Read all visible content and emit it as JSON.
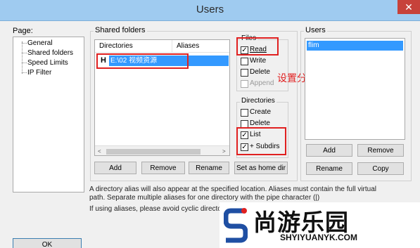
{
  "window": {
    "title": "Users",
    "close": "✕"
  },
  "page": {
    "label": "Page:",
    "items": [
      "General",
      "Shared folders",
      "Speed Limits",
      "IP Filter"
    ]
  },
  "shared_folders": {
    "label": "Shared folders",
    "columns": [
      "Directories",
      "Aliases"
    ],
    "row": {
      "marker": "H",
      "path": "E:\\02 视频资源"
    },
    "buttons": {
      "add": "Add",
      "remove": "Remove",
      "rename": "Rename",
      "set_home": "Set as home dir"
    }
  },
  "files": {
    "label": "Files",
    "read": "Read",
    "write": "Write",
    "delete": "Delete",
    "append": "Append"
  },
  "directories": {
    "label": "Directories",
    "create": "Create",
    "delete": "Delete",
    "list": "List",
    "subdirs": "+ Subdirs"
  },
  "users": {
    "label": "Users",
    "items": [
      "flim"
    ],
    "buttons": {
      "add": "Add",
      "remove": "Remove",
      "rename": "Rename",
      "copy": "Copy"
    }
  },
  "info": {
    "line1": "A directory alias will also appear at the specified location. Aliases must contain the full virtual",
    "line2": "path. Separate multiple aliases for one directory with the pipe character (|)",
    "line3": "If using aliases, please avoid cyclic directory"
  },
  "ok_button": "OK",
  "annotation": "设置分享文件夹，勾选如图",
  "watermark": {
    "cn": "尚游乐园",
    "en": "SHYIYUANYK.COM"
  },
  "colors": {
    "titlebar": "#9fcbf0",
    "selection": "#3399ff",
    "annotation": "#e02020",
    "close": "#c7423a"
  }
}
